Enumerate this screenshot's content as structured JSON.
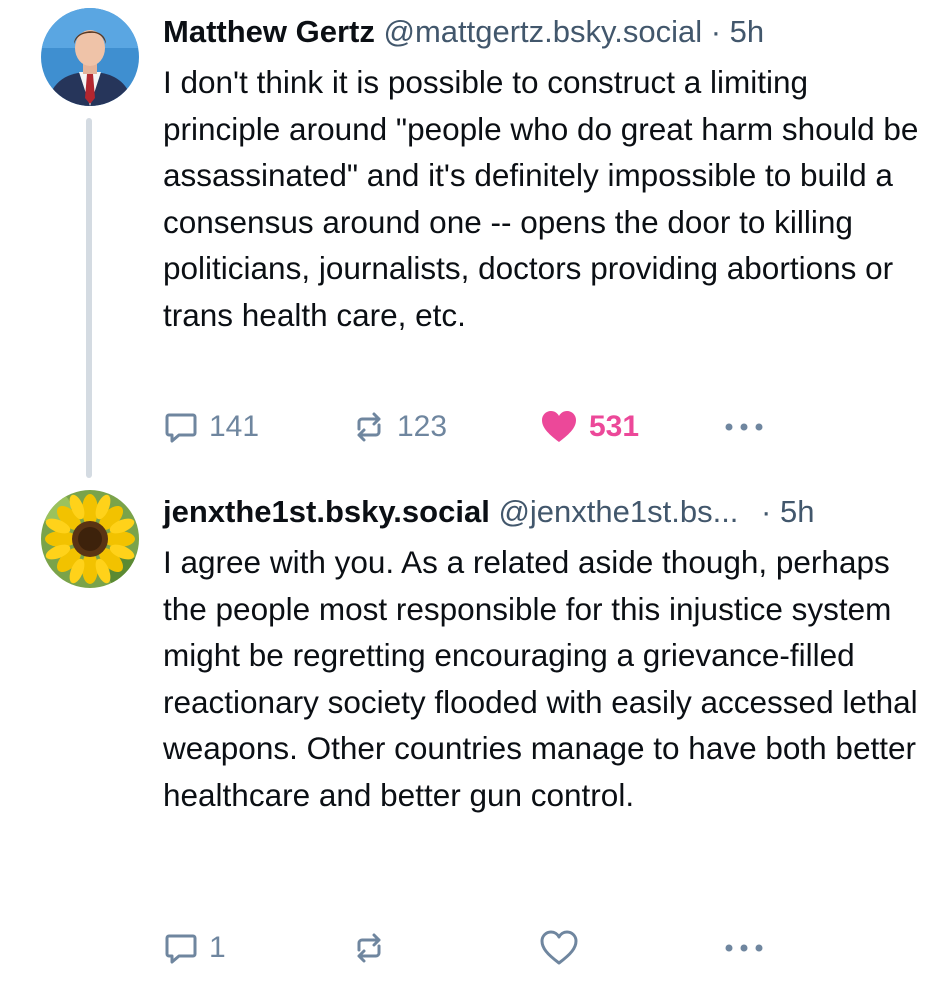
{
  "posts": [
    {
      "author": {
        "display_name": "Matthew Gertz",
        "handle": "@mattgertz.bsky.social",
        "avatar": "person-avatar"
      },
      "separator": "·",
      "time": "5h",
      "text": "I don't think it is possible to construct a limiting principle around \"people who do great harm should be assassinated\" and it's definitely impossible to build a consensus around one -- opens the door to killing politicians, journalists, doctors providing abortions or trans health care, etc.",
      "actions": {
        "replies": "141",
        "reposts": "123",
        "likes": "531",
        "liked": true
      }
    },
    {
      "author": {
        "display_name": "jenxthe1st.bsky.social",
        "handle": "@jenxthe1st.bs...",
        "avatar": "sunflower-avatar"
      },
      "separator": "·",
      "time": "5h",
      "text": "I agree with you. As a related aside though, perhaps the people most responsible for this injustice system might be regretting encouraging a grievance-filled reactionary society flooded with easily accessed lethal weapons. Other countries manage to have both better healthcare and better gun control.",
      "actions": {
        "replies": "1",
        "reposts": "",
        "likes": "",
        "liked": false
      }
    }
  ],
  "colors": {
    "text": "#0b0f14",
    "muted": "#42576c",
    "icon": "#6f869f",
    "like": "#ec4899",
    "thread_line": "#d4dbe2"
  },
  "icons": [
    "reply-icon",
    "repost-icon",
    "heart-icon",
    "more-icon"
  ]
}
